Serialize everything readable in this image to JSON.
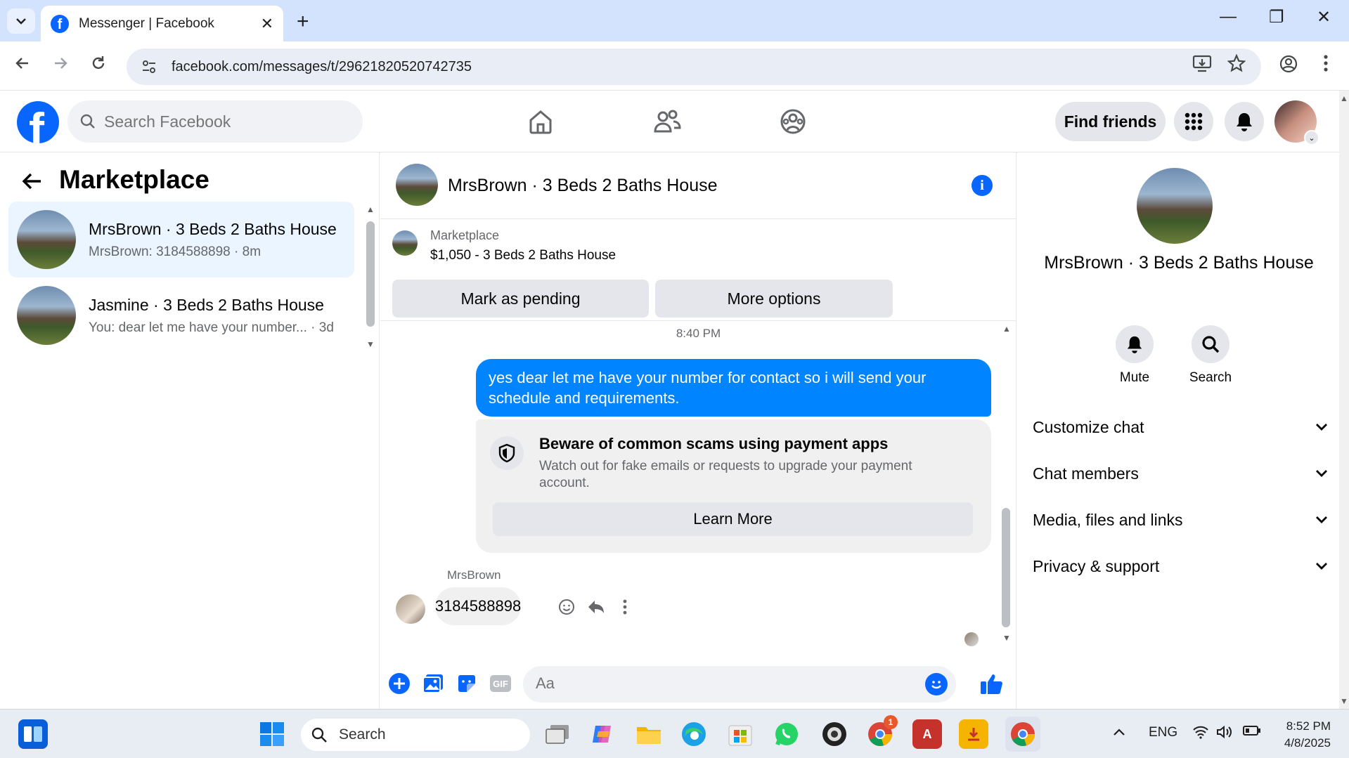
{
  "browser": {
    "tab_title": "Messenger | Facebook",
    "url": "facebook.com/messages/t/29621820520742735"
  },
  "fb": {
    "search_placeholder": "Search Facebook",
    "find_friends": "Find friends"
  },
  "left": {
    "title": "Marketplace",
    "conversations": [
      {
        "name": "MrsBrown · 3 Beds 2 Baths House",
        "preview": "MrsBrown: 3184588898 · 8m"
      },
      {
        "name": "Jasmine · 3 Beds 2 Baths House",
        "preview": "You: dear let me have your number... · 3d"
      }
    ]
  },
  "chat": {
    "title": "MrsBrown · 3 Beds 2 Baths House",
    "marketplace_label": "Marketplace",
    "listing": "$1,050 - 3 Beds 2 Baths House",
    "mark_pending": "Mark as pending",
    "more_options": "More options",
    "timestamp": "8:40 PM",
    "outgoing": "yes dear let me have your number for contact  so i will send  your schedule and requirements.",
    "warning_title": "Beware of common scams using payment apps",
    "warning_text": "Watch out for fake emails or requests to upgrade your payment account.",
    "learn_more": "Learn More",
    "sender": "MrsBrown",
    "incoming": "3184588898",
    "composer_placeholder": "Aa"
  },
  "right": {
    "name": "MrsBrown · 3 Beds 2 Baths House",
    "mute": "Mute",
    "search": "Search",
    "sections": [
      "Customize chat",
      "Chat members",
      "Media, files and links",
      "Privacy & support"
    ]
  },
  "taskbar": {
    "search": "Search",
    "lang": "ENG",
    "time": "8:52 PM",
    "date": "4/8/2025",
    "chrome_badge": "1"
  }
}
